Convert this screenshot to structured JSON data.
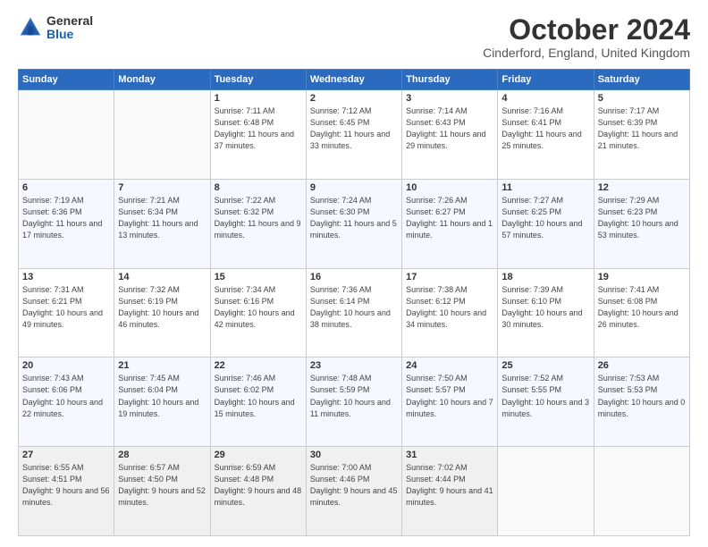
{
  "header": {
    "logo": {
      "general": "General",
      "blue": "Blue"
    },
    "title": "October 2024",
    "subtitle": "Cinderford, England, United Kingdom"
  },
  "calendar": {
    "weekdays": [
      "Sunday",
      "Monday",
      "Tuesday",
      "Wednesday",
      "Thursday",
      "Friday",
      "Saturday"
    ],
    "weeks": [
      [
        {
          "day": "",
          "info": ""
        },
        {
          "day": "",
          "info": ""
        },
        {
          "day": "1",
          "info": "Sunrise: 7:11 AM\nSunset: 6:48 PM\nDaylight: 11 hours\nand 37 minutes."
        },
        {
          "day": "2",
          "info": "Sunrise: 7:12 AM\nSunset: 6:45 PM\nDaylight: 11 hours\nand 33 minutes."
        },
        {
          "day": "3",
          "info": "Sunrise: 7:14 AM\nSunset: 6:43 PM\nDaylight: 11 hours\nand 29 minutes."
        },
        {
          "day": "4",
          "info": "Sunrise: 7:16 AM\nSunset: 6:41 PM\nDaylight: 11 hours\nand 25 minutes."
        },
        {
          "day": "5",
          "info": "Sunrise: 7:17 AM\nSunset: 6:39 PM\nDaylight: 11 hours\nand 21 minutes."
        }
      ],
      [
        {
          "day": "6",
          "info": "Sunrise: 7:19 AM\nSunset: 6:36 PM\nDaylight: 11 hours\nand 17 minutes."
        },
        {
          "day": "7",
          "info": "Sunrise: 7:21 AM\nSunset: 6:34 PM\nDaylight: 11 hours\nand 13 minutes."
        },
        {
          "day": "8",
          "info": "Sunrise: 7:22 AM\nSunset: 6:32 PM\nDaylight: 11 hours\nand 9 minutes."
        },
        {
          "day": "9",
          "info": "Sunrise: 7:24 AM\nSunset: 6:30 PM\nDaylight: 11 hours\nand 5 minutes."
        },
        {
          "day": "10",
          "info": "Sunrise: 7:26 AM\nSunset: 6:27 PM\nDaylight: 11 hours\nand 1 minute."
        },
        {
          "day": "11",
          "info": "Sunrise: 7:27 AM\nSunset: 6:25 PM\nDaylight: 10 hours\nand 57 minutes."
        },
        {
          "day": "12",
          "info": "Sunrise: 7:29 AM\nSunset: 6:23 PM\nDaylight: 10 hours\nand 53 minutes."
        }
      ],
      [
        {
          "day": "13",
          "info": "Sunrise: 7:31 AM\nSunset: 6:21 PM\nDaylight: 10 hours\nand 49 minutes."
        },
        {
          "day": "14",
          "info": "Sunrise: 7:32 AM\nSunset: 6:19 PM\nDaylight: 10 hours\nand 46 minutes."
        },
        {
          "day": "15",
          "info": "Sunrise: 7:34 AM\nSunset: 6:16 PM\nDaylight: 10 hours\nand 42 minutes."
        },
        {
          "day": "16",
          "info": "Sunrise: 7:36 AM\nSunset: 6:14 PM\nDaylight: 10 hours\nand 38 minutes."
        },
        {
          "day": "17",
          "info": "Sunrise: 7:38 AM\nSunset: 6:12 PM\nDaylight: 10 hours\nand 34 minutes."
        },
        {
          "day": "18",
          "info": "Sunrise: 7:39 AM\nSunset: 6:10 PM\nDaylight: 10 hours\nand 30 minutes."
        },
        {
          "day": "19",
          "info": "Sunrise: 7:41 AM\nSunset: 6:08 PM\nDaylight: 10 hours\nand 26 minutes."
        }
      ],
      [
        {
          "day": "20",
          "info": "Sunrise: 7:43 AM\nSunset: 6:06 PM\nDaylight: 10 hours\nand 22 minutes."
        },
        {
          "day": "21",
          "info": "Sunrise: 7:45 AM\nSunset: 6:04 PM\nDaylight: 10 hours\nand 19 minutes."
        },
        {
          "day": "22",
          "info": "Sunrise: 7:46 AM\nSunset: 6:02 PM\nDaylight: 10 hours\nand 15 minutes."
        },
        {
          "day": "23",
          "info": "Sunrise: 7:48 AM\nSunset: 5:59 PM\nDaylight: 10 hours\nand 11 minutes."
        },
        {
          "day": "24",
          "info": "Sunrise: 7:50 AM\nSunset: 5:57 PM\nDaylight: 10 hours\nand 7 minutes."
        },
        {
          "day": "25",
          "info": "Sunrise: 7:52 AM\nSunset: 5:55 PM\nDaylight: 10 hours\nand 3 minutes."
        },
        {
          "day": "26",
          "info": "Sunrise: 7:53 AM\nSunset: 5:53 PM\nDaylight: 10 hours\nand 0 minutes."
        }
      ],
      [
        {
          "day": "27",
          "info": "Sunrise: 6:55 AM\nSunset: 4:51 PM\nDaylight: 9 hours\nand 56 minutes."
        },
        {
          "day": "28",
          "info": "Sunrise: 6:57 AM\nSunset: 4:50 PM\nDaylight: 9 hours\nand 52 minutes."
        },
        {
          "day": "29",
          "info": "Sunrise: 6:59 AM\nSunset: 4:48 PM\nDaylight: 9 hours\nand 48 minutes."
        },
        {
          "day": "30",
          "info": "Sunrise: 7:00 AM\nSunset: 4:46 PM\nDaylight: 9 hours\nand 45 minutes."
        },
        {
          "day": "31",
          "info": "Sunrise: 7:02 AM\nSunset: 4:44 PM\nDaylight: 9 hours\nand 41 minutes."
        },
        {
          "day": "",
          "info": ""
        },
        {
          "day": "",
          "info": ""
        }
      ]
    ]
  }
}
